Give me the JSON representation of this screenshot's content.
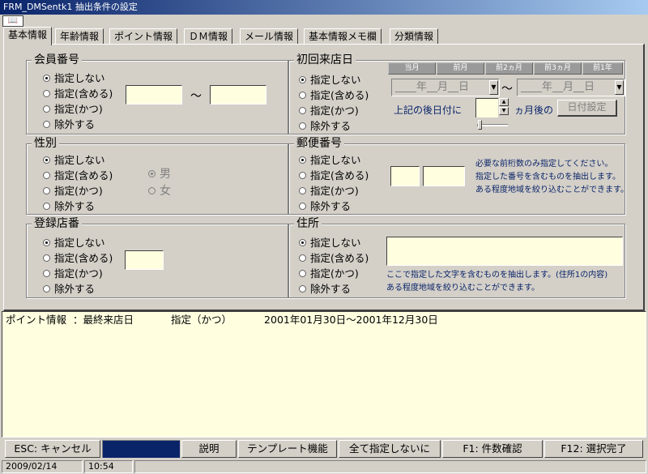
{
  "window": {
    "title": "FRM_DMSentk1 抽出条件の設定",
    "icon": "book-icon"
  },
  "tabs": [
    {
      "label": "基本情報",
      "active": true
    },
    {
      "label": "年齢情報"
    },
    {
      "label": "ポイント情報"
    },
    {
      "label": "ＤＭ情報"
    },
    {
      "label": "メール情報"
    },
    {
      "label": "基本情報メモ欄"
    },
    {
      "label": "分類情報"
    }
  ],
  "radio_options": {
    "none": "指定しない",
    "include": "指定(含める)",
    "and": "指定(かつ)",
    "exclude": "除外する"
  },
  "member_number": {
    "title": "会員番号",
    "range_separator": "～",
    "from_value": "",
    "to_value": ""
  },
  "gender": {
    "title": "性別",
    "male": "男",
    "female": "女"
  },
  "store": {
    "title": "登録店番",
    "value": ""
  },
  "first_visit": {
    "title": "初回来店日",
    "quick_buttons": [
      "当月",
      "前月",
      "前2ヵ月",
      "前3ヵ月",
      "前1年"
    ],
    "date_from": "____年__月__日",
    "date_to": "____年__月__日",
    "separator": "～",
    "after_label": "上記の後日付に",
    "months_after_label": "ヵ月後の",
    "months_value": "",
    "set_button": "日付設定"
  },
  "postal": {
    "title": "郵便番号",
    "value1": "",
    "value2": "",
    "notes": [
      "必要な前桁数のみ指定してください。",
      "指定した番号を含むものを抽出します。",
      "ある程度地域を絞り込むことができます。"
    ]
  },
  "address": {
    "title": "住所",
    "value": "",
    "notes": [
      "ここで指定した文字を含むものを抽出します。(住所1の内容)",
      "ある程度地域を絞り込むことができます。"
    ]
  },
  "summary": {
    "lines": [
      {
        "category": "ポイント情報",
        "field": "：最終来店日",
        "mode": "指定（かつ）",
        "value": "2001年01月30日～2001年12月30日"
      }
    ]
  },
  "function_keys": {
    "cancel": "ESC: キャンセル",
    "help": "説明",
    "template": "テンプレート機能",
    "reset_all": "全て指定しないに",
    "count": "F1: 件数確認",
    "finish": "F12: 選択完了"
  },
  "status": {
    "date": "2009/02/14",
    "time": "10:54"
  }
}
